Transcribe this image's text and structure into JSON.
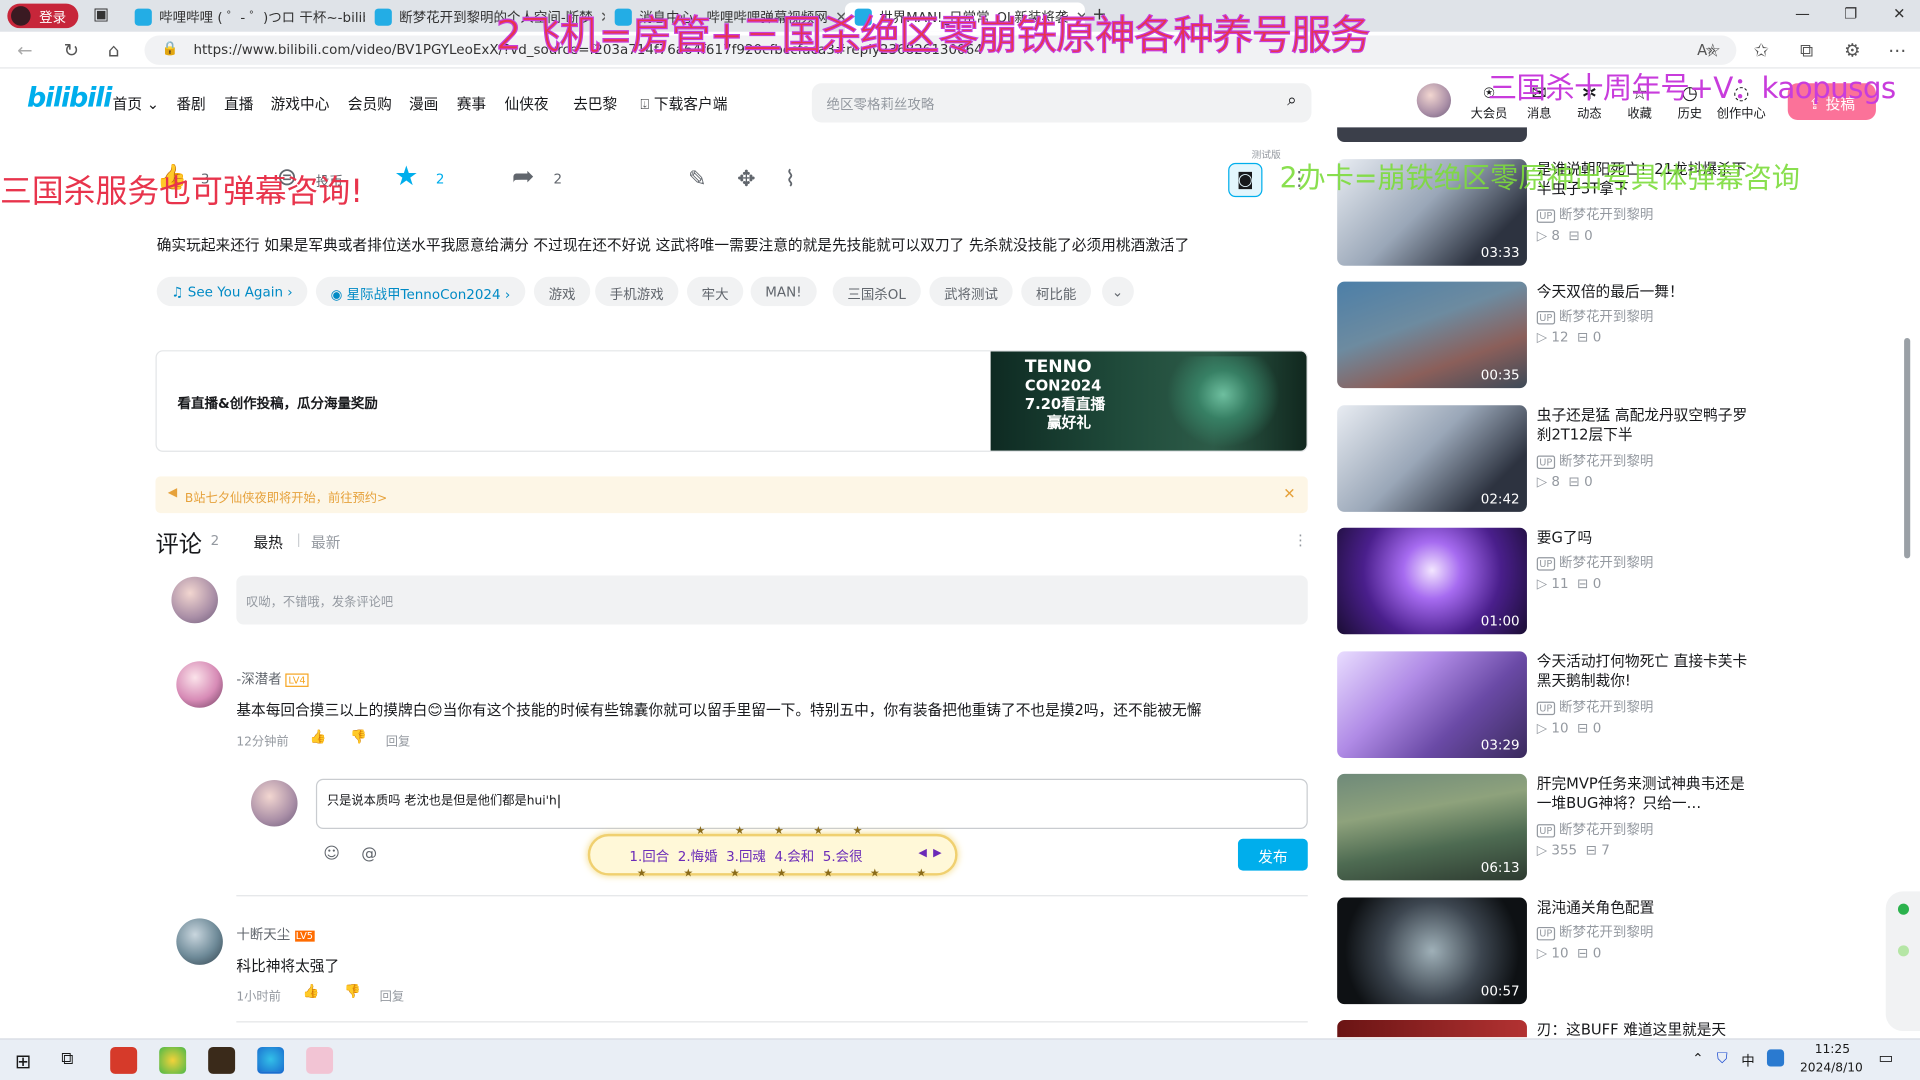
{
  "browser": {
    "login_badge": "登录",
    "tabs": [
      {
        "title": "哔哩哔哩 ( ゜- ゜)つロ 干杯~-bilib"
      },
      {
        "title": "断梦花开到黎明的个人空间-断梦"
      },
      {
        "title": "消息中心 - 哔哩哔哩弹幕视频网"
      },
      {
        "title": "世界MAN!_日常常_OL新装将袭"
      }
    ],
    "url": "https://www.bilibili.com/video/BV1PGYLeoExX/?vd_source=f203a714f76a64f617f920cfbccfaca3#reply236826130064"
  },
  "header": {
    "logo": "bilibili",
    "nav": [
      "首页",
      "番剧",
      "直播",
      "游戏中心",
      "会员购",
      "漫画",
      "赛事",
      "仙侠夜",
      "去巴黎",
      "下载客户端"
    ],
    "search_placeholder": "绝区零格莉丝攻略",
    "icons": [
      {
        "label": "大会员"
      },
      {
        "label": "消息"
      },
      {
        "label": "动态"
      },
      {
        "label": "收藏"
      },
      {
        "label": "历史"
      },
      {
        "label": "创作中心"
      }
    ],
    "upload_label": "投稿"
  },
  "video": {
    "like_count": "3",
    "coin_label": "投币",
    "fav_count": "2",
    "share_count": "2",
    "test_badge": "测试版",
    "description": "确实玩起来还行 如果是军典或者排位送水平我愿意给满分 不过现在还不好说 这武将唯一需要注意的就是先技能就可以双刀了 先杀就没技能了必须用桃酒激活了",
    "tags": [
      "See You Again",
      "星际战甲TennoCon2024",
      "游戏",
      "手机游戏",
      "牢大",
      "MAN!",
      "三国杀OL",
      "武将测试",
      "柯比能"
    ],
    "banner_text": "看直播&创作投稿，瓜分海量奖励",
    "banner_image_line1": "TENNO",
    "banner_image_line2": "CON2024",
    "banner_image_line3": "7.20看直播",
    "banner_image_line4": "赢好礼",
    "notice": "B站七夕仙侠夜即将开始，前往预约>"
  },
  "comments": {
    "title": "评论",
    "count": "2",
    "sort_hot": "最热",
    "sort_new": "最新",
    "input_placeholder": "叹呦，不错哦，发条评论吧",
    "items": [
      {
        "user": "-深潜者",
        "level": "LV4",
        "text": "基本每回合摸三以上的摸牌白😊当你有这个技能的时候有些锦囊你就可以留手里留一下。特别五中，你有装备把他重铸了不也是摸2吗，还不能被无懈",
        "time": "12分钟前",
        "reply": "回复"
      },
      {
        "user": "十断天尘",
        "level": "LV5",
        "text": "科比神将太强了",
        "time": "1小时前",
        "reply": "回复"
      }
    ],
    "reply_draft": "只是说本质吗 老沈也是但是他们都是hui'h",
    "ime_candidates": "1.回合  2.悔婚  3.回魂  4.会和  5.会很",
    "publish_label": "发布"
  },
  "recommendations": [
    {
      "title": "是谁说朝阳死亡！21龙抖爆杀下半虫子3T拿下",
      "author": "断梦花开到黎明",
      "views": "8",
      "danmaku": "0",
      "duration": "03:33"
    },
    {
      "title": "今天双倍的最后一舞！",
      "author": "断梦花开到黎明",
      "views": "12",
      "danmaku": "0",
      "duration": "00:35"
    },
    {
      "title": "虫子还是猛 高配龙丹驭空鸭子罗刹2T12层下半",
      "author": "断梦花开到黎明",
      "views": "8",
      "danmaku": "0",
      "duration": "02:42"
    },
    {
      "title": "要G了吗",
      "author": "断梦花开到黎明",
      "views": "11",
      "danmaku": "0",
      "duration": "01:00"
    },
    {
      "title": "今天活动打何物死亡 直接卡芙卡黑天鹅制裁你!",
      "author": "断梦花开到黎明",
      "views": "10",
      "danmaku": "0",
      "duration": "03:29"
    },
    {
      "title": "肝完MVP任务来测试神典韦还是一堆BUG神将？只给一…",
      "author": "断梦花开到黎明",
      "views": "355",
      "danmaku": "7",
      "duration": "06:13"
    },
    {
      "title": "混沌通关角色配置",
      "author": "断梦花开到黎明",
      "views": "10",
      "danmaku": "0",
      "duration": "00:57"
    },
    {
      "title": "刃：这BUFF 难道这里就是天",
      "author": "",
      "views": "",
      "danmaku": "",
      "duration": ""
    }
  ],
  "overlays": {
    "top": "2飞机=房管+三国杀绝区零崩铁原神各种养号服务",
    "right_top": "三国杀十周年号+V：kaopusgs",
    "left": "三国杀服务也可弹幕咨询!",
    "right_green": "2办卡=崩铁绝区零原神出号具体弹幕咨询"
  },
  "taskbar": {
    "time": "11:25",
    "date": "2024/8/10",
    "ime": "中"
  },
  "colors": {
    "bili_pink": "#fb7299",
    "bili_blue": "#00aeec",
    "overlay_red": "#e8344c",
    "overlay_magenta": "#c83cdc",
    "overlay_green": "#7ddc3c"
  }
}
